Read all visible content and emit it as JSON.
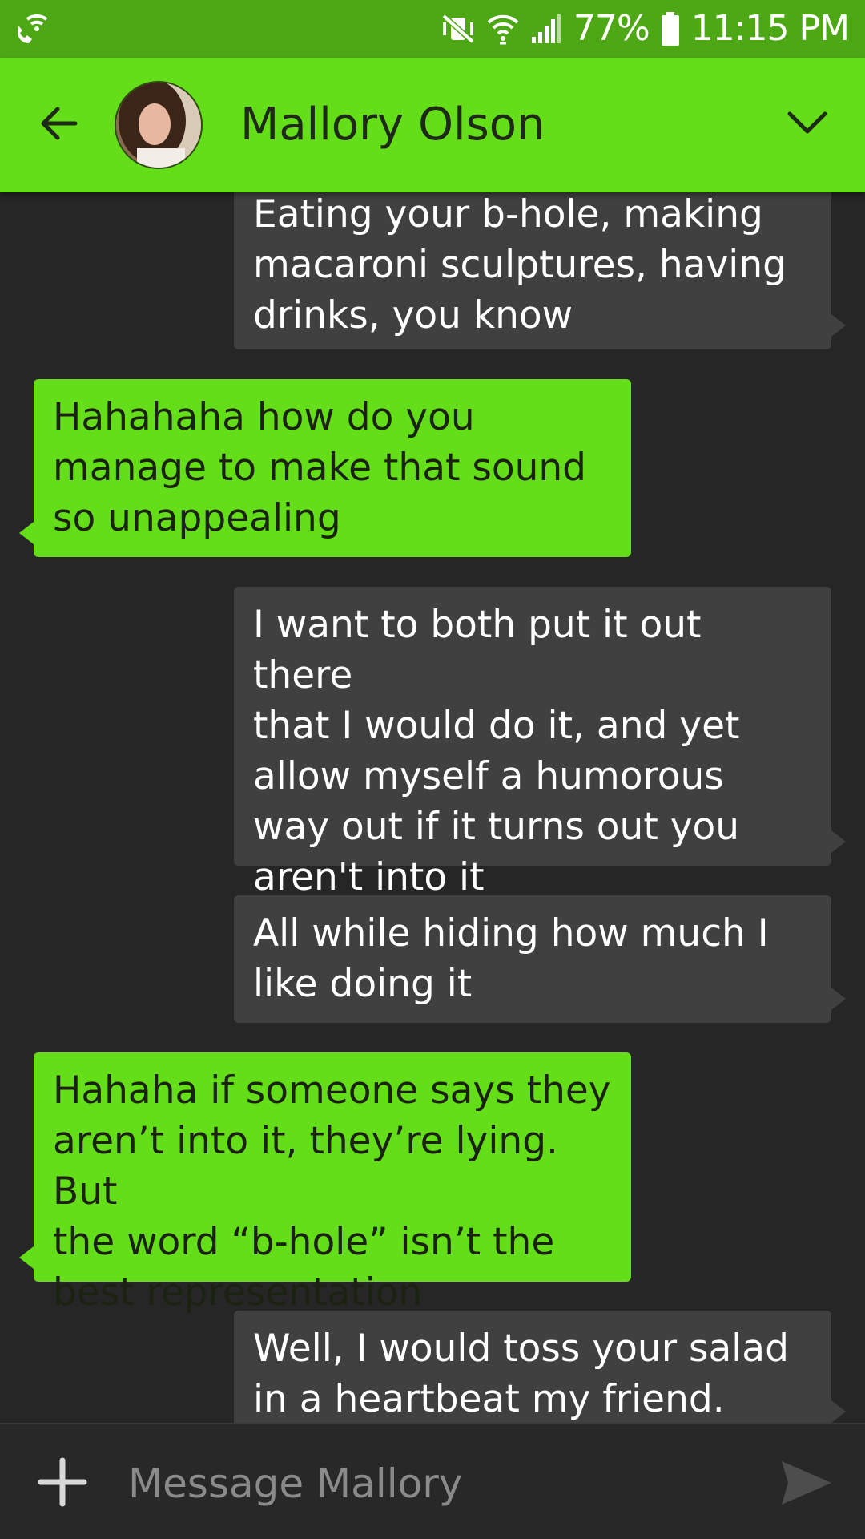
{
  "status_bar": {
    "battery_percent": "77%",
    "time": "11:15 PM",
    "icons": [
      "wifi-calling-icon",
      "vibrate-mute-icon",
      "wifi-icon",
      "signal-icon",
      "battery-icon"
    ]
  },
  "header": {
    "contact_name": "Mallory Olson",
    "icons": [
      "back-arrow-icon",
      "avatar",
      "chevron-down-icon"
    ]
  },
  "messages": [
    {
      "direction": "out",
      "text": "Eating your b-hole, making\nmacaroni sculptures, having\ndrinks, you know"
    },
    {
      "direction": "in",
      "text": "Hahahaha how do you\nmanage to make that sound\nso unappealing"
    },
    {
      "direction": "out",
      "text": "I want to both put it out there\nthat I would do it, and yet\nallow myself a humorous\nway out if it turns out you\naren't into it"
    },
    {
      "direction": "out",
      "text": "All while hiding how much I\nlike doing it"
    },
    {
      "direction": "in",
      "text": "Hahaha if someone says they\naren’t into it, they’re lying. But\nthe word “b-hole” isn’t the\nbest representation"
    },
    {
      "direction": "out",
      "text": "Well, I would toss your salad\nin a heartbeat my friend."
    }
  ],
  "composer": {
    "placeholder": "Message Mallory",
    "icons": [
      "plus-icon",
      "send-icon"
    ]
  },
  "colors": {
    "status_bar": "#4ea715",
    "app_bar": "#64de18",
    "background": "#262626",
    "outgoing_bubble": "#404040",
    "incoming_bubble": "#64de18"
  }
}
